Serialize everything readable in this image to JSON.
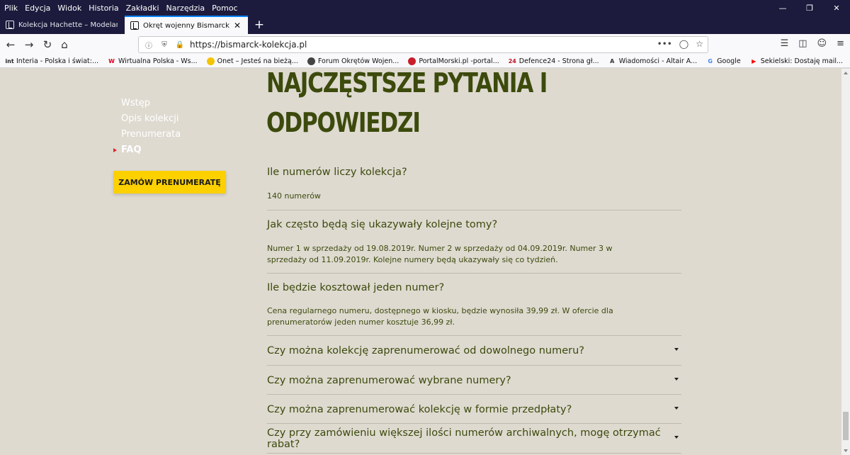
{
  "menubar": {
    "items": [
      "Plik",
      "Edycja",
      "Widok",
      "Historia",
      "Zakładki",
      "Narzędzia",
      "Pomoc"
    ]
  },
  "window_controls": {
    "minimize_icon": "minimize-icon",
    "restore_icon": "restore-icon",
    "close_icon": "close-icon"
  },
  "tabs": [
    {
      "title": "Kolekcja Hachette – Modelarst"
    },
    {
      "title": "Okręt wojenny Bismarck"
    }
  ],
  "navbar": {
    "url": "https://bismarck-kolekcja.pl",
    "more_glyph": "•••"
  },
  "bookmarks": [
    {
      "label": "Interia - Polska i świat:...",
      "icon": "int",
      "color": "#222222"
    },
    {
      "label": "Wirtualna Polska - Ws...",
      "icon": "W",
      "color": "#e2001a"
    },
    {
      "label": "Onet – Jesteś na bieżą...",
      "icon": "",
      "color": "#f5c400"
    },
    {
      "label": "Forum Okrętów Wojen...",
      "icon": "",
      "color": "#444444"
    },
    {
      "label": "PortalMorski.pl -portal...",
      "icon": "",
      "color": "#c81e2a"
    },
    {
      "label": "Defence24 - Strona gł...",
      "icon": "24",
      "color": "#c1121f"
    },
    {
      "label": "Wiadomości - Altair A...",
      "icon": "A",
      "color": "#333333"
    },
    {
      "label": "Google",
      "icon": "G",
      "color": "#4285f4"
    },
    {
      "label": "Sekielski: Dostaję mail...",
      "icon": "▶",
      "color": "#ff0000"
    }
  ],
  "sidenav": {
    "items": [
      "Wstęp",
      "Opis kolekcji",
      "Prenumerata",
      "FAQ"
    ],
    "active_index": 3
  },
  "order_button": "ZAMÓW PRENUMERATĘ",
  "page_title_line1": "NAJCZĘSTSZE PYTANIA I",
  "page_title_line2": "ODPOWIEDZI",
  "faq": [
    {
      "q": "Ile numerów liczy kolekcja?",
      "a": "140 numerów",
      "expanded": true
    },
    {
      "q": "Jak często będą się ukazywały kolejne tomy?",
      "a": "Numer 1 w sprzedaży od 19.08.2019r. Numer 2 w sprzedaży od 04.09.2019r. Numer 3 w sprzedaży od 11.09.2019r. Kolejne numery będą ukazywały się co tydzień.",
      "expanded": true
    },
    {
      "q": "Ile będzie kosztował jeden numer?",
      "a": "Cena regularnego numeru, dostępnego w kiosku, będzie wynosiła 39,99 zł. W ofercie dla prenumeratorów jeden numer kosztuje 36,99 zł.",
      "expanded": true
    },
    {
      "q": "Czy można kolekcję zaprenumerować od dowolnego numeru?",
      "expanded": false
    },
    {
      "q": "Czy można zaprenumerować wybrane numery?",
      "expanded": false
    },
    {
      "q": "Czy można zaprenumerować kolekcję w formie przedpłaty?",
      "expanded": false
    },
    {
      "q": "Czy przy zamówieniu większej ilości numerów archiwalnych, mogę otrzymać rabat?",
      "expanded": false
    }
  ],
  "colors": {
    "page_bg": "#dedad0",
    "heading": "#3c4a0c",
    "accent_button": "#fdd000",
    "active_marker": "#e0262a",
    "browser_chrome": "#1c1b3d"
  }
}
